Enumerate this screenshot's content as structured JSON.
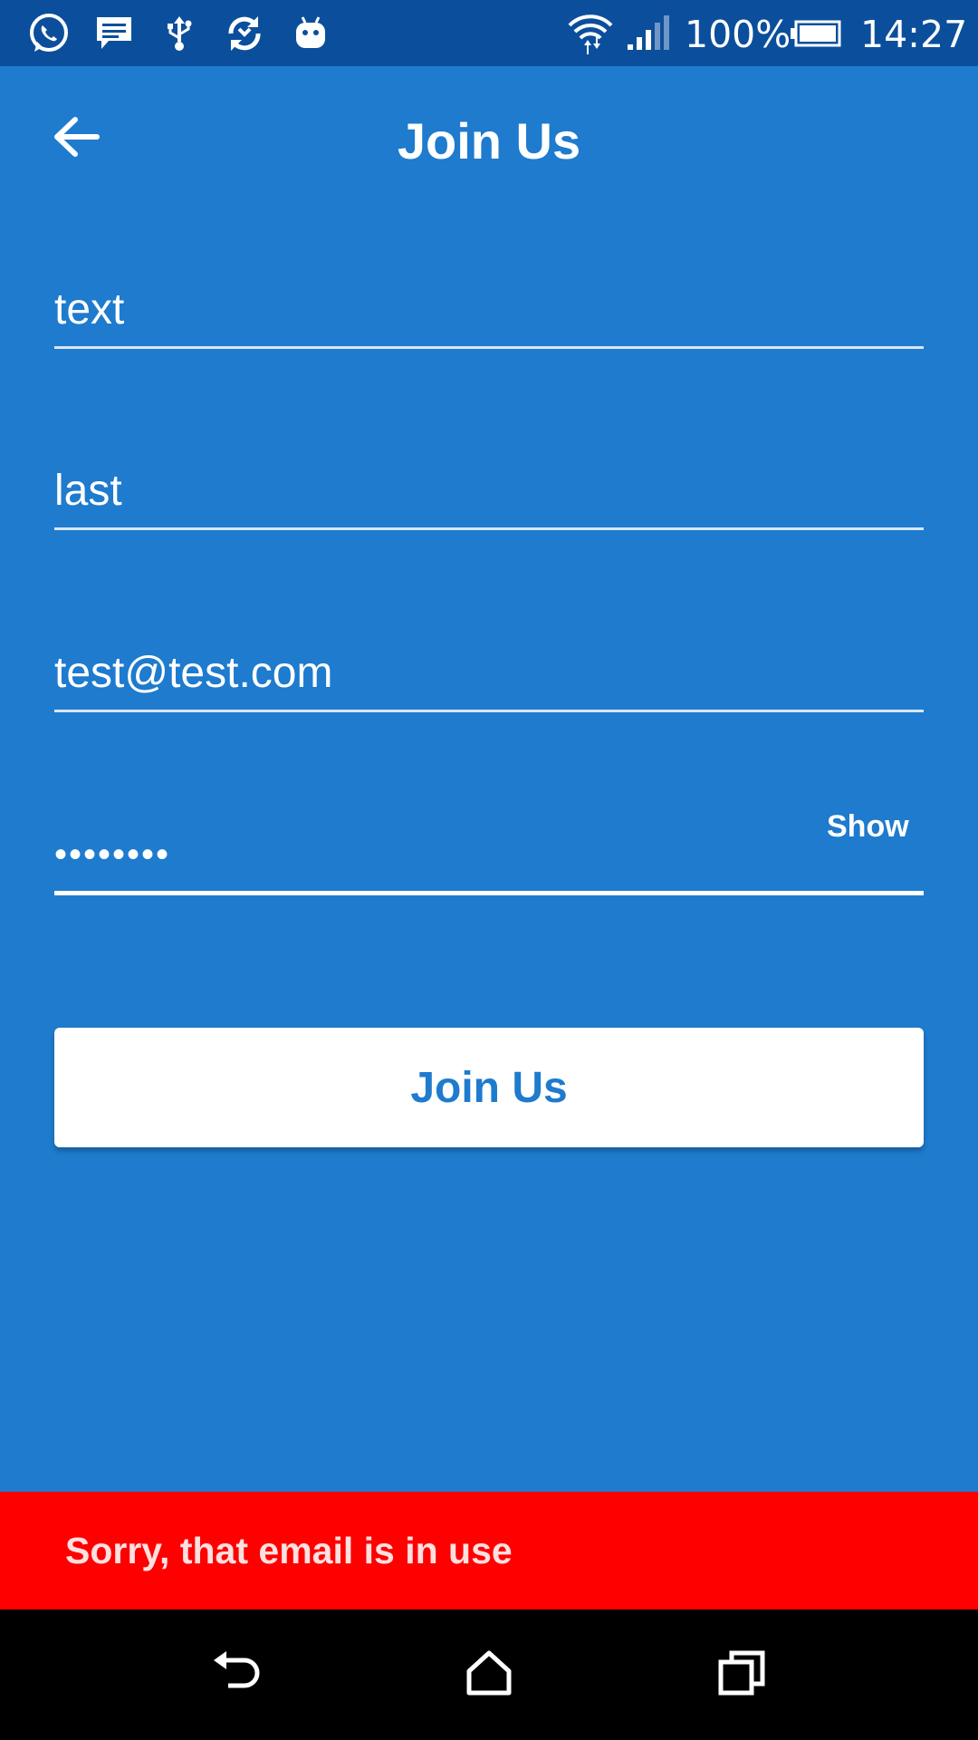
{
  "status_bar": {
    "battery_text": "100%",
    "time": "14:27",
    "icons": [
      "whatsapp-icon",
      "message-icon",
      "usb-icon",
      "sync-icon",
      "android-icon",
      "wifi-icon",
      "signal-icon",
      "battery-icon"
    ]
  },
  "header": {
    "title": "Join Us",
    "back_icon": "arrow-left-icon"
  },
  "form": {
    "first_name": "text",
    "last_name": "last",
    "email": "test@test.com",
    "password_masked": "••••••••",
    "show_label": "Show",
    "submit_label": "Join Us"
  },
  "snackbar": {
    "message": "Sorry, that email is in use",
    "color": "#ff0000"
  },
  "colors": {
    "primary": "#1e7bce",
    "status_bar": "#0b4f9c",
    "error": "#ff0000"
  },
  "nav_bar": {
    "buttons": [
      "back-icon",
      "home-icon",
      "recents-icon"
    ]
  }
}
